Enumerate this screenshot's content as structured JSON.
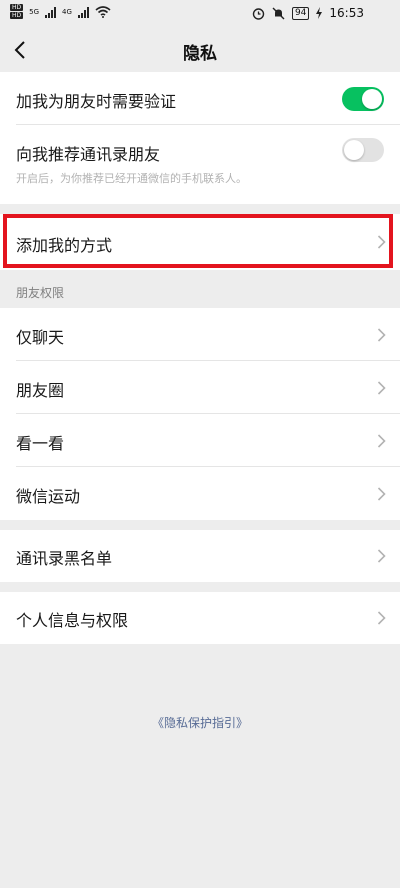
{
  "status_bar": {
    "sim1": "HD",
    "sim2": "HD",
    "net1": "5G",
    "net2": "4G",
    "battery": "94",
    "time": "16:53"
  },
  "nav": {
    "back_icon": "chevron-left-icon",
    "title": "隐私"
  },
  "settings": {
    "verify_friend": {
      "label": "加我为朋友时需要验证",
      "enabled": true
    },
    "recommend_contacts": {
      "label": "向我推荐通讯录朋友",
      "enabled": false,
      "hint": "开启后，为你推荐已经开通微信的手机联系人。"
    },
    "add_me_methods": {
      "label": "添加我的方式"
    }
  },
  "friend_permissions": {
    "section_title": "朋友权限",
    "items": [
      {
        "label": "仅聊天"
      },
      {
        "label": "朋友圈"
      },
      {
        "label": "看一看"
      },
      {
        "label": "微信运动"
      }
    ]
  },
  "blacklist": {
    "label": "通讯录黑名单"
  },
  "personal_info": {
    "label": "个人信息与权限"
  },
  "footer": {
    "privacy_guide": "《隐私保护指引》"
  },
  "colors": {
    "accent_green": "#07c160",
    "highlight_red": "#e3141e",
    "link_blue": "#576b95",
    "background": "#ededed"
  }
}
